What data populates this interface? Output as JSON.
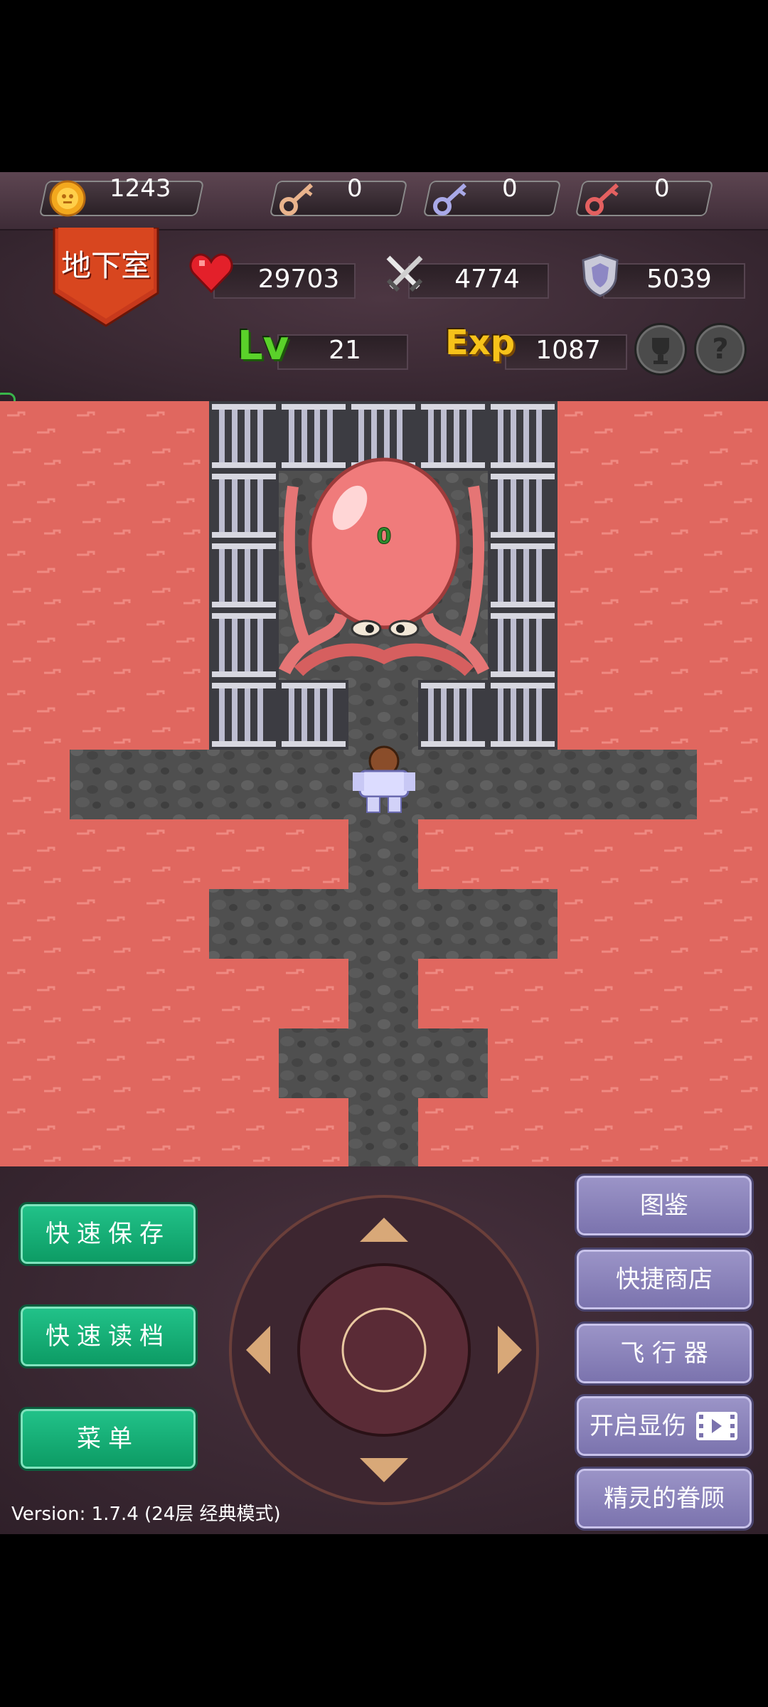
{
  "resources": {
    "gold": "1243",
    "yellow_key": "0",
    "blue_key": "0",
    "red_key": "0"
  },
  "floor": {
    "name": "地下室"
  },
  "stats": {
    "hp": "29703",
    "attack": "4774",
    "defense": "5039",
    "level_label": "Lv",
    "level": "21",
    "exp_label": "Exp",
    "exp": "1087"
  },
  "map": {
    "boss_marker": "0"
  },
  "buttons": {
    "quick_save": "快速保存",
    "quick_load": "快速读档",
    "menu": "菜单",
    "bestiary": "图鉴",
    "quick_shop": "快捷商店",
    "flyer": "飞 行 器",
    "show_damage": "开启显伤",
    "fairy": "精灵的眷顾"
  },
  "version": "Version: 1.7.4 (24层 经典模式)",
  "icons": [
    "gold-coin-icon",
    "yellow-key-icon",
    "blue-key-icon",
    "red-key-icon",
    "heart-icon",
    "swords-icon",
    "shield-icon",
    "trophy-icon",
    "help-icon",
    "video-icon"
  ],
  "colors": {
    "lava": "#e0675f",
    "floor": "#4f4f4f",
    "green_button": "#12b078",
    "purple_button": "#8a83bc"
  }
}
